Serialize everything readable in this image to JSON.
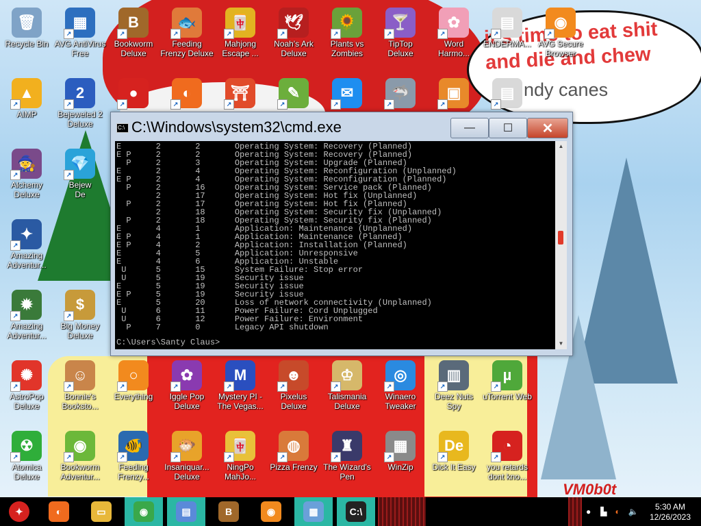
{
  "speech": {
    "line1": "it's time to eat shit",
    "line2": "and die and chew",
    "line3": "ndy canes"
  },
  "signature": "VM0b0t",
  "desktop_icons": [
    {
      "label": "Recycle Bin",
      "icon": "recycle-bin-icon",
      "color": "#7fa3c7",
      "glyph": "🗑",
      "shortcut": false
    },
    {
      "label": "AVG AntiVirus\nFree",
      "icon": "avg-antivirus-icon",
      "color": "#2d6fbf",
      "glyph": "▦",
      "shortcut": true
    },
    {
      "label": "Bookworm\nDeluxe",
      "icon": "bookworm-icon",
      "color": "#a0682a",
      "glyph": "B",
      "shortcut": true
    },
    {
      "label": "Feeding\nFrenzy Deluxe",
      "icon": "feeding-frenzy-icon",
      "color": "#e07a3a",
      "glyph": "🐟",
      "shortcut": true
    },
    {
      "label": "Mahjong\nEscape ...",
      "icon": "mahjong-icon",
      "color": "#e2b321",
      "glyph": "🀄",
      "shortcut": true
    },
    {
      "label": "Noah's Ark\nDeluxe",
      "icon": "noahs-ark-icon",
      "color": "#b61f1f",
      "glyph": "🕊",
      "shortcut": true
    },
    {
      "label": "Plants vs\nZombies",
      "icon": "plants-vs-zombies-icon",
      "color": "#6aa13a",
      "glyph": "🌻",
      "shortcut": true
    },
    {
      "label": "TipTop\nDeluxe",
      "icon": "tiptop-icon",
      "color": "#8a5ec7",
      "glyph": "🍸",
      "shortcut": true
    },
    {
      "label": "Word\nHarmo...",
      "icon": "word-harmony-icon",
      "color": "#f19fb7",
      "glyph": "✿",
      "shortcut": true
    },
    {
      "label": "ENDERMA...",
      "icon": "enderman-icon",
      "color": "#d9d9d9",
      "glyph": "▤",
      "shortcut": true
    },
    {
      "label": "AVG Secure\nBrowser",
      "icon": "avg-browser-icon",
      "color": "#f28a1e",
      "glyph": "◉",
      "shortcut": true
    },
    {
      "label": "AIMP",
      "icon": "aimp-icon",
      "color": "#f2b01e",
      "glyph": "▲",
      "shortcut": true
    },
    {
      "label": "Bejeweled 2\nDeluxe",
      "icon": "bejeweled-icon",
      "color": "#2b5dbf",
      "glyph": "2",
      "shortcut": true
    },
    {
      "label": "",
      "icon": "red-creature-icon",
      "color": "#d6221f",
      "glyph": "●",
      "shortcut": true
    },
    {
      "label": "",
      "icon": "firefox-icon",
      "color": "#f06b1e",
      "glyph": "◐",
      "shortcut": true
    },
    {
      "label": "",
      "icon": "torii-gate-icon",
      "color": "#e14b2a",
      "glyph": "⛩",
      "shortcut": true
    },
    {
      "label": "",
      "icon": "notepad-frog-icon",
      "color": "#6cae3c",
      "glyph": "✎",
      "shortcut": true
    },
    {
      "label": "",
      "icon": "messenger-icon",
      "color": "#1e8ef0",
      "glyph": "✉",
      "shortcut": true
    },
    {
      "label": "",
      "icon": "shark-icon",
      "color": "#8a9aaa",
      "glyph": "🦈",
      "shortcut": true
    },
    {
      "label": "",
      "icon": "orange-cube-icon",
      "color": "#e8892a",
      "glyph": "▣",
      "shortcut": true
    },
    {
      "label": "",
      "icon": "window-icon",
      "color": "#d9d9d9",
      "glyph": "▤",
      "shortcut": true
    },
    {
      "label": "Alchemy\nDeluxe",
      "icon": "alchemy-icon",
      "color": "#7a4a8a",
      "glyph": "🧙",
      "shortcut": true
    },
    {
      "label": "Bejew\nDe",
      "icon": "bejeweled-diamond-icon",
      "color": "#2aa3d9",
      "glyph": "💎",
      "shortcut": true
    },
    {
      "label": "Amazing\nAdventur...",
      "icon": "amazing-adventures-1-icon",
      "color": "#2a5aa3",
      "glyph": "✦",
      "shortcut": true
    },
    {
      "label": "Amazing\nAdventur...",
      "icon": "amazing-adventures-2-icon",
      "color": "#3a7a3a",
      "glyph": "✹",
      "shortcut": true
    },
    {
      "label": "Big Money\nDeluxe",
      "icon": "big-money-icon",
      "color": "#c79a3a",
      "glyph": "$",
      "shortcut": true
    },
    {
      "label": "AstroPop\nDeluxe",
      "icon": "astropop-icon",
      "color": "#e1352a",
      "glyph": "✺",
      "shortcut": true
    },
    {
      "label": "Bonnie's\nBooksto...",
      "icon": "bonnies-bookstore-icon",
      "color": "#c9854a",
      "glyph": "☺",
      "shortcut": true
    },
    {
      "label": "Everything",
      "icon": "everything-search-icon",
      "color": "#f28a1e",
      "glyph": "○",
      "shortcut": true
    },
    {
      "label": "Iggle Pop\nDeluxe",
      "icon": "iggle-pop-icon",
      "color": "#8a3ab0",
      "glyph": "✿",
      "shortcut": true
    },
    {
      "label": "Mystery PI -\nThe Vegas...",
      "icon": "mystery-pi-icon",
      "color": "#2a4fbf",
      "glyph": "M",
      "shortcut": true
    },
    {
      "label": "Pixelus Deluxe",
      "icon": "pixelus-icon",
      "color": "#c74a2a",
      "glyph": "☻",
      "shortcut": true
    },
    {
      "label": "Talismania\nDeluxe",
      "icon": "talismania-icon",
      "color": "#d6b86a",
      "glyph": "♔",
      "shortcut": true
    },
    {
      "label": "Winaero\nTweaker",
      "icon": "winaero-icon",
      "color": "#2a8ae0",
      "glyph": "◎",
      "shortcut": true
    },
    {
      "label": "Deez Nuts\nSpy",
      "icon": "deez-nuts-icon",
      "color": "#5a6a7a",
      "glyph": "▥",
      "shortcut": true
    },
    {
      "label": "uTorrent Web",
      "icon": "utorrent-icon",
      "color": "#4fa83a",
      "glyph": "µ",
      "shortcut": true
    },
    {
      "label": "Atomica\nDeluxe",
      "icon": "atomica-icon",
      "color": "#2fae3a",
      "glyph": "☢",
      "shortcut": true
    },
    {
      "label": "Bookworm\nAdventur...",
      "icon": "bookworm-adventures-icon",
      "color": "#6cb83a",
      "glyph": "◉",
      "shortcut": true
    },
    {
      "label": "Feeding\nFrenzy...",
      "icon": "feeding-frenzy-2-icon",
      "color": "#2a6ab0",
      "glyph": "🐠",
      "shortcut": true
    },
    {
      "label": "Insaniquar...\nDeluxe",
      "icon": "insaniquarium-icon",
      "color": "#e8a32a",
      "glyph": "🐡",
      "shortcut": true
    },
    {
      "label": "NingPo\nMahJo...",
      "icon": "ningpo-icon",
      "color": "#e8c13a",
      "glyph": "🀄",
      "shortcut": true
    },
    {
      "label": "Pizza Frenzy",
      "icon": "pizza-frenzy-icon",
      "color": "#d97a3a",
      "glyph": "◍",
      "shortcut": true
    },
    {
      "label": "The Wizard's\nPen",
      "icon": "wizards-pen-icon",
      "color": "#3a3a6a",
      "glyph": "♜",
      "shortcut": true
    },
    {
      "label": "WinZip",
      "icon": "winzip-icon",
      "color": "#8a8a8a",
      "glyph": "▦",
      "shortcut": true
    },
    {
      "label": "Dick It Easy",
      "icon": "dick-it-easy-icon",
      "color": "#e8b81e",
      "glyph": "De",
      "shortcut": true
    },
    {
      "label": "you retards\ndont kno...",
      "icon": "red-dragon-icon",
      "color": "#d6221f",
      "glyph": "◔",
      "shortcut": true
    }
  ],
  "cmd": {
    "title": "C:\\Windows\\system32\\cmd.exe",
    "lines": [
      "E       2       2       Operating System: Recovery (Planned)",
      "E P     2       2       Operating System: Recovery (Planned)",
      "  P     2       3       Operating System: Upgrade (Planned)",
      "E       2       4       Operating System: Reconfiguration (Unplanned)",
      "E P     2       4       Operating System: Reconfiguration (Planned)",
      "  P     2       16      Operating System: Service pack (Planned)",
      "        2       17      Operating System: Hot fix (Unplanned)",
      "  P     2       17      Operating System: Hot fix (Planned)",
      "        2       18      Operating System: Security fix (Unplanned)",
      "  P     2       18      Operating System: Security fix (Planned)",
      "E       4       1       Application: Maintenance (Unplanned)",
      "E P     4       1       Application: Maintenance (Planned)",
      "E P     4       2       Application: Installation (Planned)",
      "E       4       5       Application: Unresponsive",
      "E       4       6       Application: Unstable",
      " U      5       15      System Failure: Stop error",
      " U      5       19      Security issue",
      "E       5       19      Security issue",
      "E P     5       19      Security issue",
      "E       5       20      Loss of network connectivity (Unplanned)",
      " U      6       11      Power Failure: Cord Unplugged",
      " U      6       12      Power Failure: Environment",
      "  P     7       0       Legacy API shutdown"
    ],
    "prompt": "C:\\Users\\Santy Claus>",
    "minimize_label": "—",
    "maximize_label": "☐",
    "close_label": "✕"
  },
  "taskbar": {
    "start_icon": "santa-start-icon",
    "buttons": [
      {
        "icon": "firefox-icon",
        "glyph": "◐",
        "color": "#f06b1e"
      },
      {
        "icon": "file-explorer-icon",
        "glyph": "▭",
        "color": "#e8b83a"
      },
      {
        "icon": "chrome-icon",
        "glyph": "◉",
        "color": "#3aa84a"
      },
      {
        "icon": "control-panel-icon",
        "glyph": "▤",
        "color": "#5a8ad9"
      },
      {
        "icon": "bookworm-icon",
        "glyph": "B",
        "color": "#a0682a"
      },
      {
        "icon": "avg-browser-icon",
        "glyph": "◉",
        "color": "#f28a1e"
      },
      {
        "icon": "network-computer-icon",
        "glyph": "▦",
        "color": "#6aa0d9"
      },
      {
        "icon": "cmd-icon",
        "glyph": "C:\\",
        "color": "#222222"
      }
    ]
  },
  "clock": {
    "time": "5:30 AM",
    "date": "12/26/2023"
  }
}
